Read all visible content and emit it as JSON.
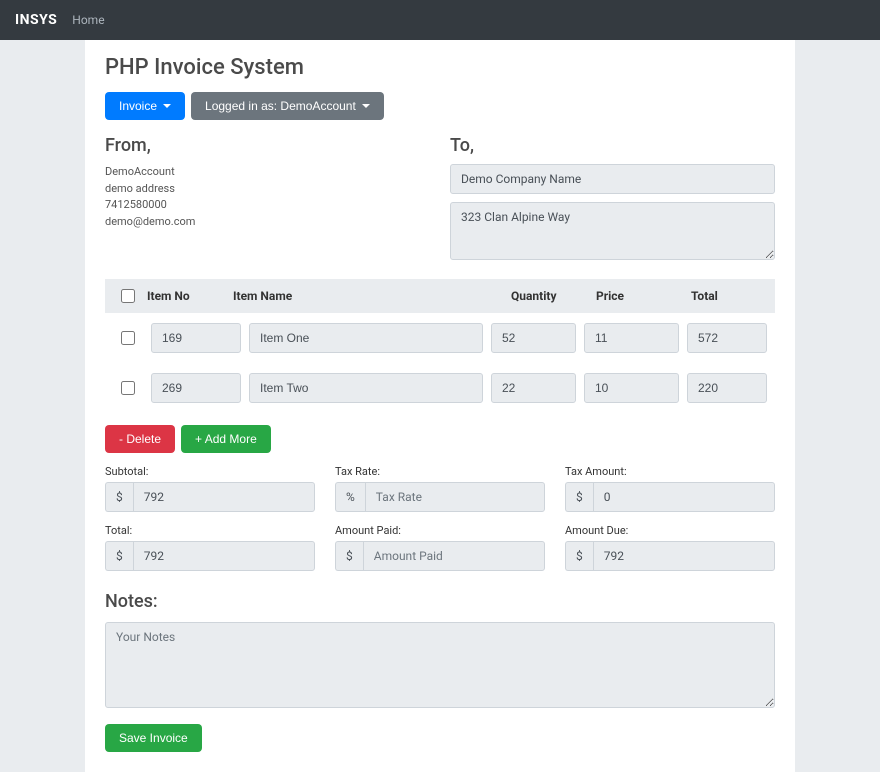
{
  "navbar": {
    "brand": "INSYS",
    "home": "Home"
  },
  "page_title": "PHP Invoice System",
  "buttons": {
    "invoice": "Invoice",
    "logged_in": "Logged in as: DemoAccount",
    "delete": "- Delete",
    "add_more": "+ Add More",
    "save": "Save Invoice"
  },
  "from": {
    "heading": "From,",
    "name": "DemoAccount",
    "address": "demo address",
    "phone": "7412580000",
    "email": "demo@demo.com"
  },
  "to": {
    "heading": "To,",
    "company_value": "Demo Company Name",
    "address_value": "323 Clan Alpine Way"
  },
  "table": {
    "headers": {
      "item_no": "Item No",
      "item_name": "Item Name",
      "quantity": "Quantity",
      "price": "Price",
      "total": "Total"
    },
    "rows": [
      {
        "no": "169",
        "name": "Item One",
        "qty": "52",
        "price": "11",
        "total": "572"
      },
      {
        "no": "269",
        "name": "Item Two",
        "qty": "22",
        "price": "10",
        "total": "220"
      }
    ]
  },
  "totals": {
    "subtotal_label": "Subtotal:",
    "subtotal_value": "792",
    "tax_rate_label": "Tax Rate:",
    "tax_rate_placeholder": "Tax Rate",
    "tax_amount_label": "Tax Amount:",
    "tax_amount_value": "0",
    "total_label": "Total:",
    "total_value": "792",
    "amount_paid_label": "Amount Paid:",
    "amount_paid_placeholder": "Amount Paid",
    "amount_due_label": "Amount Due:",
    "amount_due_value": "792",
    "dollar": "$",
    "percent": "%"
  },
  "notes": {
    "heading": "Notes:",
    "placeholder": "Your Notes"
  }
}
